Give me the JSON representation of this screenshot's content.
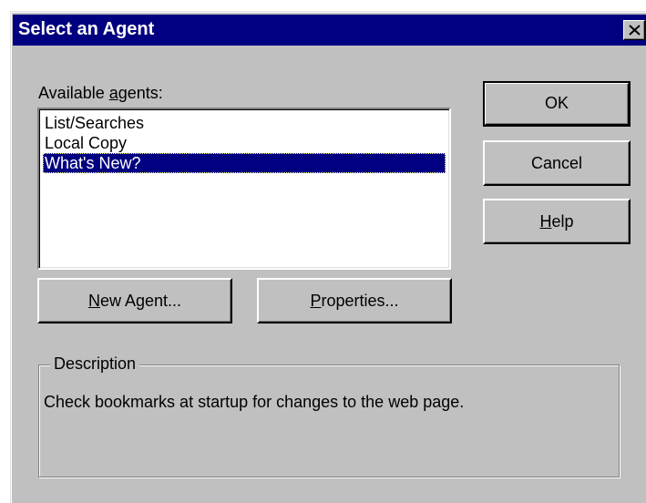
{
  "dialog": {
    "title": "Select an Agent",
    "close_icon": "close-x-icon"
  },
  "agents": {
    "label_pre": "Available ",
    "label_mnemonic": "a",
    "label_post": "gents:",
    "items": [
      "List/Searches",
      "Local Copy",
      "What's New?"
    ],
    "selected": "What's New?"
  },
  "buttons": {
    "ok": "OK",
    "cancel": "Cancel",
    "help_mnemonic": "H",
    "help_rest": "elp",
    "new_agent_mnemonic": "N",
    "new_agent_rest": "ew Agent...",
    "properties_mnemonic": "P",
    "properties_rest": "roperties..."
  },
  "description": {
    "legend": "Description",
    "text": "Check bookmarks at startup for changes to the web page."
  },
  "colors": {
    "titlebar": "#000080",
    "face": "#c0c0c0",
    "selection": "#000080"
  }
}
